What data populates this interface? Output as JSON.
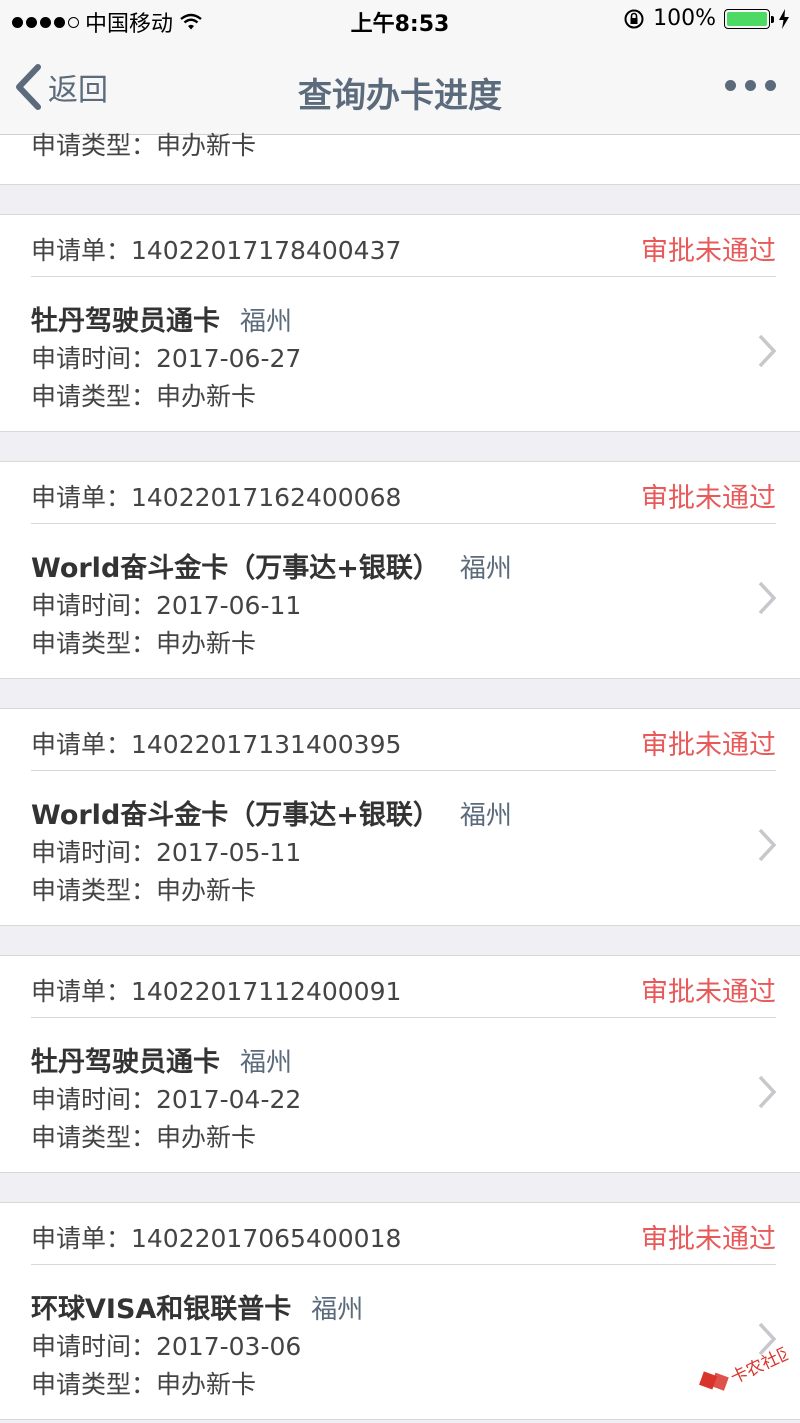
{
  "status_bar": {
    "carrier": "中国移动",
    "time": "上午8:53",
    "battery": "100%"
  },
  "nav": {
    "back_label": "返回",
    "title": "查询办卡进度"
  },
  "partial": {
    "type_line": "申请类型：申办新卡"
  },
  "applications": [
    {
      "order": "申请单：14022017178400437",
      "status": "审批未通过",
      "card_name": "牡丹驾驶员通卡",
      "city": "福州",
      "time_line": "申请时间：2017-06-27",
      "type_line": "申请类型：申办新卡"
    },
    {
      "order": "申请单：14022017162400068",
      "status": "审批未通过",
      "card_name": "World奋斗金卡（万事达+银联）",
      "city": "福州",
      "time_line": "申请时间：2017-06-11",
      "type_line": "申请类型：申办新卡"
    },
    {
      "order": "申请单：14022017131400395",
      "status": "审批未通过",
      "card_name": "World奋斗金卡（万事达+银联）",
      "city": "福州",
      "time_line": "申请时间：2017-05-11",
      "type_line": "申请类型：申办新卡"
    },
    {
      "order": "申请单：14022017112400091",
      "status": "审批未通过",
      "card_name": "牡丹驾驶员通卡",
      "city": "福州",
      "time_line": "申请时间：2017-04-22",
      "type_line": "申请类型：申办新卡"
    },
    {
      "order": "申请单：14022017065400018",
      "status": "审批未通过",
      "card_name": "环球VISA和银联普卡",
      "city": "福州",
      "time_line": "申请时间：2017-03-06",
      "type_line": "申请类型：申办新卡"
    }
  ],
  "watermark": "卡农社区",
  "colors": {
    "reject": "#e85a5a",
    "nav_text": "#5b6b7c",
    "battery": "#4cd964"
  }
}
